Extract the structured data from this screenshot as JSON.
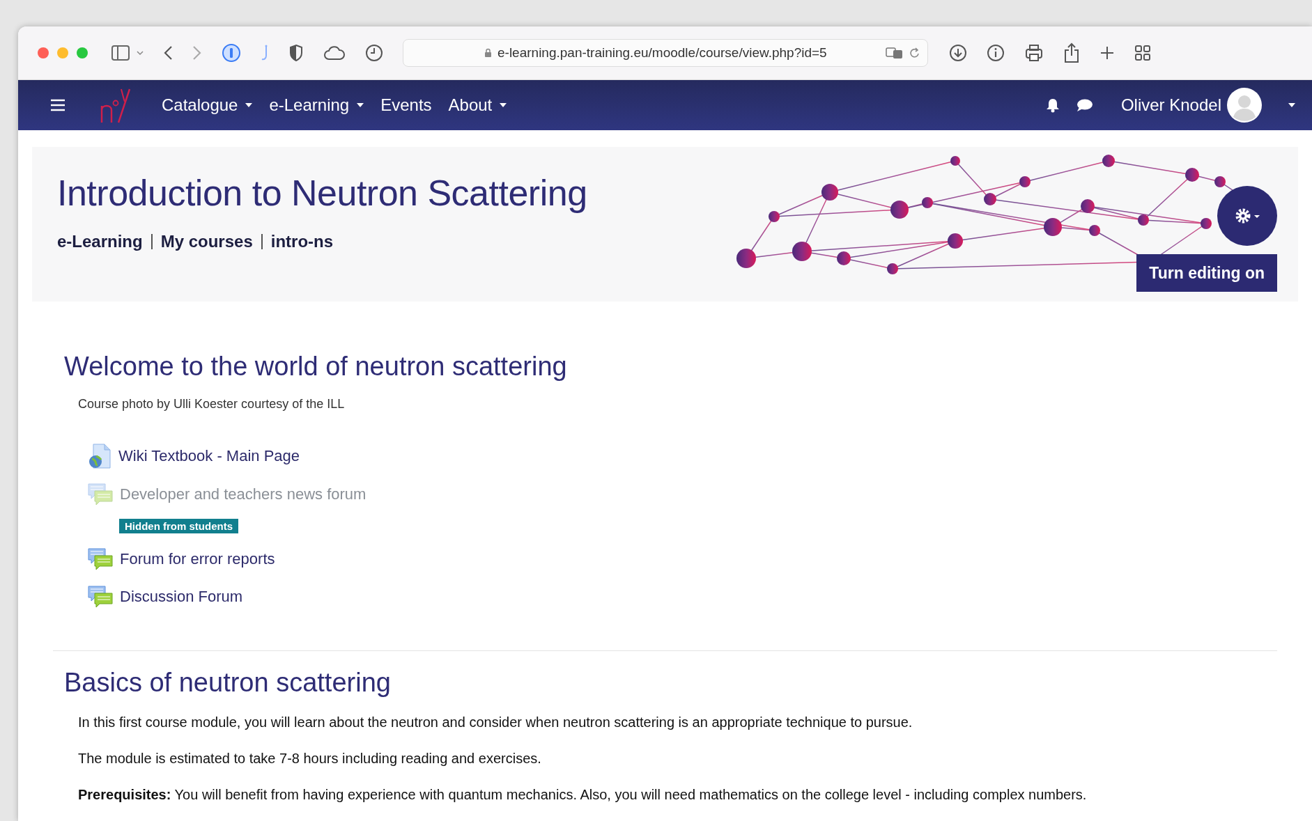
{
  "browser": {
    "url": "e-learning.pan-training.eu/moodle/course/view.php?id=5"
  },
  "navbar": {
    "menu": [
      {
        "label": "Catalogue",
        "has_dropdown": true
      },
      {
        "label": "e-Learning",
        "has_dropdown": true
      },
      {
        "label": "Events",
        "has_dropdown": false
      },
      {
        "label": "About",
        "has_dropdown": true
      }
    ],
    "user": "Oliver Knodel"
  },
  "header": {
    "title": "Introduction to Neutron Scattering",
    "breadcrumbs": [
      "e-Learning",
      "My courses",
      "intro-ns"
    ],
    "edit_button": "Turn editing on"
  },
  "sections": [
    {
      "title": "Welcome to the world of neutron scattering",
      "summary": [
        "Course photo by Ulli Koester courtesy of the ILL"
      ],
      "activities": [
        {
          "kind": "page",
          "name": "Wiki Textbook - Main Page",
          "hidden": false
        },
        {
          "kind": "forum",
          "name": "Developer and teachers news forum",
          "hidden": true,
          "badge": "Hidden from students"
        },
        {
          "kind": "forum",
          "name": "Forum for error reports",
          "hidden": false
        },
        {
          "kind": "forum",
          "name": "Discussion Forum",
          "hidden": false
        }
      ]
    },
    {
      "title": "Basics of neutron scattering",
      "summary": [
        "In this first course module, you will learn about the neutron and consider when neutron scattering is an appropriate technique to pursue.",
        "The module is estimated to take 7-8 hours including reading and exercises.",
        "**Prerequisites:** You will benefit from having experience with quantum mechanics. Also, you will need mathematics on the college level - including complex numbers."
      ]
    }
  ]
}
